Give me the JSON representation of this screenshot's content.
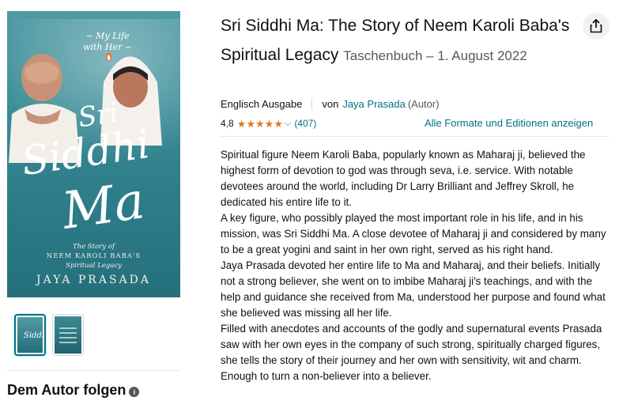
{
  "cover": {
    "subtitle_top": "~ My Life with Her ~",
    "title_line1": "Sri",
    "title_line2": "Siddhi",
    "title_line3": "Ma",
    "story_line1": "The Story of",
    "story_line2": "NEEM KAROLI BABA'S",
    "story_line3": "Spiritual Legacy",
    "author": "JAYA PRASADA",
    "publisher_logo": "penguin-logo"
  },
  "product": {
    "title": "Sri Siddhi Ma: The Story of Neem Karoli Baba's Spiritual Legacy",
    "format": "Taschenbuch – 1. August 2022",
    "edition": "Englisch Ausgabe",
    "by_label": "von",
    "author": "Jaya Prasada",
    "author_role": "(Autor)",
    "rating_value": "4,8",
    "rating_stars": 4.8,
    "rating_count": "(407)",
    "all_formats_link": "Alle Formate und Editionen anzeigen"
  },
  "description": [
    "Spiritual figure Neem Karoli Baba, popularly known as Maharaj ji, believed the highest form of devotion to god was through seva, i.e. service. With notable devotees around the world, including Dr Larry Brilliant and Jeffrey Skroll, he dedicated his entire life to it.",
    "A key figure, who possibly played the most important role in his life, and in his mission, was Sri Siddhi Ma. A close devotee of Maharaj ji and considered by many to be a great yogini and saint in her own right, served as his right hand.",
    "Jaya Prasada devoted her entire life to Ma and Maharaj, and their beliefs. Initially not a strong believer, she went on to imbibe Maharaj ji's teachings, and with the help and guidance she received from Ma, understood her purpose and found what she believed was missing all her life.",
    "Filled with anecdotes and accounts of the godly and supernatural events Prasada saw with her own eyes in the company of such strong, spiritually charged figures, she tells the story of their journey and her own with sensitivity, wit and charm. Enough to turn a non-believer into a believer."
  ],
  "follow_author": "Dem Autor folgen",
  "colors": {
    "link": "#007185",
    "star": "#de7921",
    "cover": "#3a8c97"
  }
}
